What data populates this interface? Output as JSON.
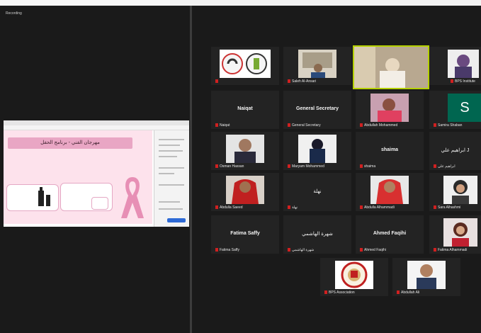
{
  "recording_label": "Recording",
  "shared_slide": {
    "title": "مهرجان الفني - برنامج الحفل"
  },
  "participants": [
    {
      "id": "r1c1",
      "label": ""
    },
    {
      "id": "r1c2",
      "label": "Saleh Al-Ansari"
    },
    {
      "id": "r1c3",
      "label": ""
    },
    {
      "id": "r1c4",
      "label": "BPS Institute"
    },
    {
      "id": "r2c1",
      "label": "Naiqat",
      "center": "Naiqat"
    },
    {
      "id": "r2c2",
      "label": "General Secretary",
      "center": "General Secretary"
    },
    {
      "id": "r2c3",
      "label": "Abdullah Mohammed"
    },
    {
      "id": "r2c4",
      "label": "Samira Shaban",
      "initial": "S"
    },
    {
      "id": "r3c1",
      "label": "Osman Hassan"
    },
    {
      "id": "r3c2",
      "label": "Maryam Mohammed"
    },
    {
      "id": "r3c3",
      "label": "shaima",
      "center": "shaima"
    },
    {
      "id": "r3c4",
      "label": "ابراهيم علي",
      "center": "ابراهيم علي J"
    },
    {
      "id": "r4c1",
      "label": "Abdulla Saeed"
    },
    {
      "id": "r4c2",
      "label": "نهلة",
      "center": "نهلة"
    },
    {
      "id": "r4c3",
      "label": "Abdulla Alhammadi"
    },
    {
      "id": "r4c4",
      "label": "Sara Alhashmi"
    },
    {
      "id": "r5c1",
      "label": "Fatima Saffy",
      "center": "Fatima Saffy"
    },
    {
      "id": "r5c2",
      "label": "شهرة الهاشمي",
      "center": "شهرة الهاشمي"
    },
    {
      "id": "r5c3",
      "label": "Ahmed Faqihi",
      "center": "Ahmed Faqihi"
    },
    {
      "id": "r5c4",
      "label": "Fatima Alhammadi"
    },
    {
      "id": "r6c1",
      "label": "BPS Association"
    },
    {
      "id": "r6c2",
      "label": "Abdullah Ali"
    }
  ]
}
